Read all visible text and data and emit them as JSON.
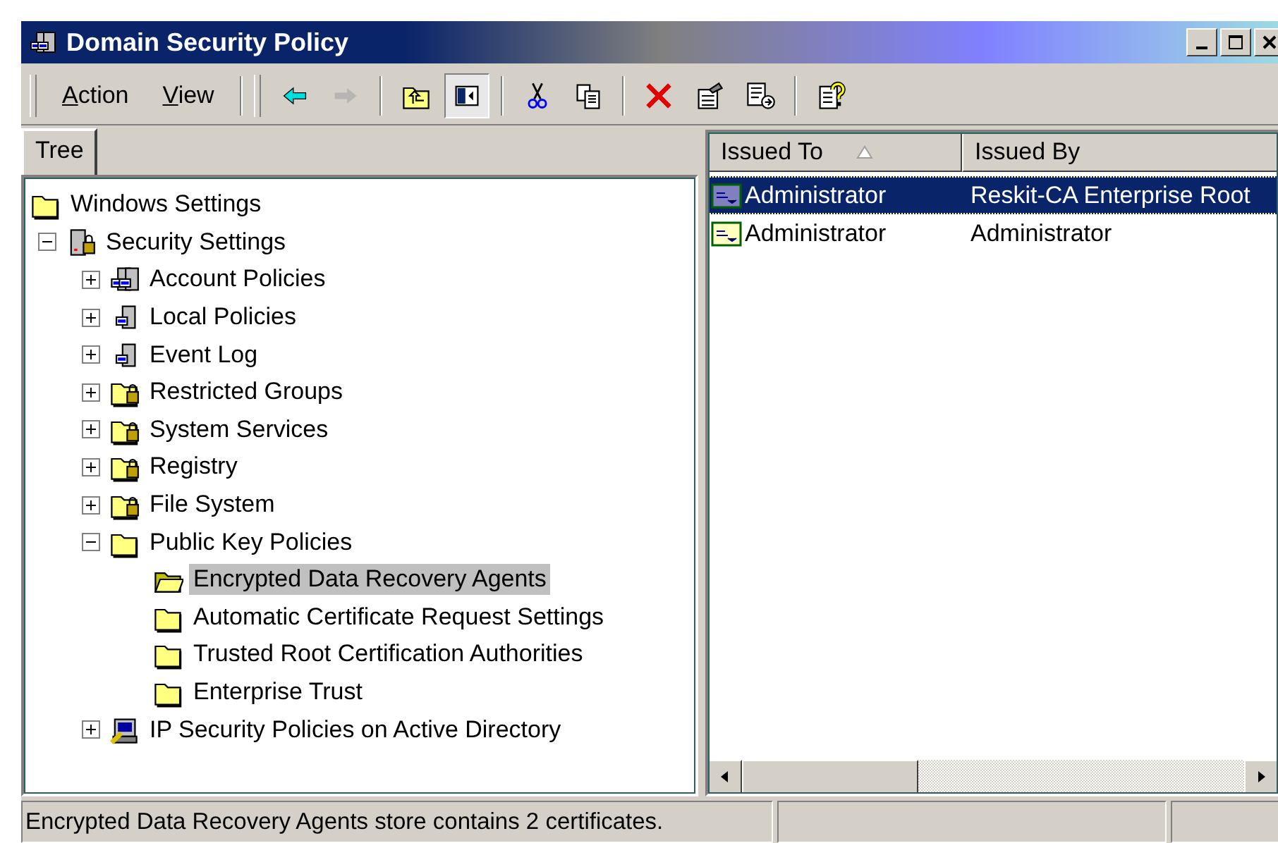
{
  "window": {
    "title": "Domain Security Policy"
  },
  "menu": [
    {
      "label": "Action"
    },
    {
      "label": "View"
    }
  ],
  "toolbar": [
    [
      {
        "kind": "back",
        "disabled": false,
        "pressed": false
      },
      {
        "kind": "forward",
        "disabled": true,
        "pressed": false
      }
    ],
    [
      {
        "kind": "up",
        "disabled": false,
        "pressed": false
      },
      {
        "kind": "tree-toggle",
        "disabled": false,
        "pressed": true
      }
    ],
    [
      {
        "kind": "cut",
        "disabled": false,
        "pressed": false
      },
      {
        "kind": "copy",
        "disabled": false,
        "pressed": false
      }
    ],
    [
      {
        "kind": "delete",
        "disabled": false,
        "pressed": false
      },
      {
        "kind": "properties",
        "disabled": false,
        "pressed": false
      },
      {
        "kind": "export",
        "disabled": false,
        "pressed": false
      }
    ],
    [
      {
        "kind": "help",
        "disabled": false,
        "pressed": false
      }
    ]
  ],
  "tabs": [
    {
      "label": "Tree",
      "selected": true
    }
  ],
  "tree": [
    {
      "label": "Windows Settings",
      "kind": "folder",
      "selected": false,
      "children": [
        {
          "label": "Security Settings",
          "kind": "lock-server",
          "expanded": true,
          "selected": false,
          "children": [
            {
              "label": "Account Policies",
              "kind": "servers",
              "expanded": false,
              "selected": false
            },
            {
              "label": "Local Policies",
              "kind": "server",
              "expanded": false,
              "selected": false
            },
            {
              "label": "Event Log",
              "kind": "server",
              "expanded": false,
              "selected": false
            },
            {
              "label": "Restricted Groups",
              "kind": "lock-folder",
              "expanded": false,
              "selected": false
            },
            {
              "label": "System Services",
              "kind": "lock-folder",
              "expanded": false,
              "selected": false
            },
            {
              "label": "Registry",
              "kind": "lock-folder",
              "expanded": false,
              "selected": false
            },
            {
              "label": "File System",
              "kind": "lock-folder",
              "expanded": false,
              "selected": false
            },
            {
              "label": "Public Key Policies",
              "kind": "folder",
              "expanded": true,
              "selected": false,
              "children": [
                {
                  "label": "Encrypted Data Recovery Agents",
                  "kind": "open-folder",
                  "selected": true
                },
                {
                  "label": "Automatic Certificate Request Settings",
                  "kind": "folder",
                  "selected": false
                },
                {
                  "label": "Trusted Root Certification Authorities",
                  "kind": "folder",
                  "selected": false
                },
                {
                  "label": "Enterprise Trust",
                  "kind": "folder",
                  "selected": false
                }
              ]
            },
            {
              "label": "IP Security Policies on Active Directory",
              "kind": "ip-security",
              "expanded": false,
              "selected": false
            }
          ]
        }
      ]
    }
  ],
  "list": {
    "columns": [
      {
        "label": "Issued To",
        "sorted": true
      },
      {
        "label": "Issued By",
        "sorted": false
      }
    ],
    "rows": [
      {
        "issued_to": "Administrator",
        "issued_by": "Reskit-CA Enterprise Root",
        "selected": true
      },
      {
        "issued_to": "Administrator",
        "issued_by": "Administrator",
        "selected": false
      }
    ]
  },
  "status_bar": {
    "text": "Encrypted Data Recovery Agents store contains 2 certificates."
  }
}
